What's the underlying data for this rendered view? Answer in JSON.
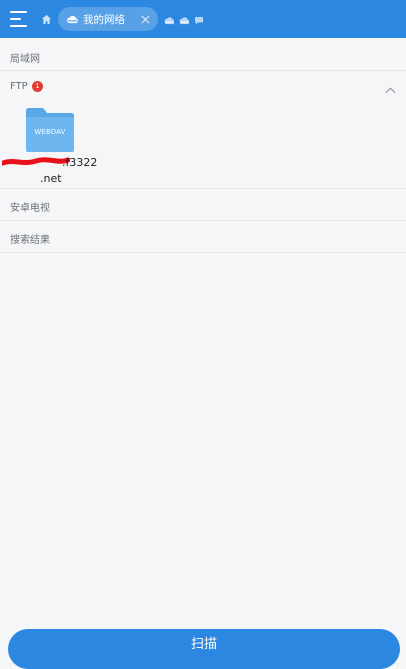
{
  "header": {
    "tab_label": "我的网络",
    "accent_color": "#2b87e0",
    "icons": [
      "menu-icon",
      "home-icon",
      "cloud-icon",
      "close-icon",
      "cloud-drive-icon",
      "cloud-drive-icon",
      "chat-icon"
    ]
  },
  "sections": {
    "lan": "局域网",
    "ftp": "FTP",
    "ftp_badge": "1",
    "android_tv": "安卓电视",
    "search_results": "搜索结果"
  },
  "ftp_item": {
    "folder_label": "WEBDAV",
    "name_line1": ".f3322",
    "name_line2": ".net"
  },
  "footer": {
    "scan_label": "扫描"
  }
}
